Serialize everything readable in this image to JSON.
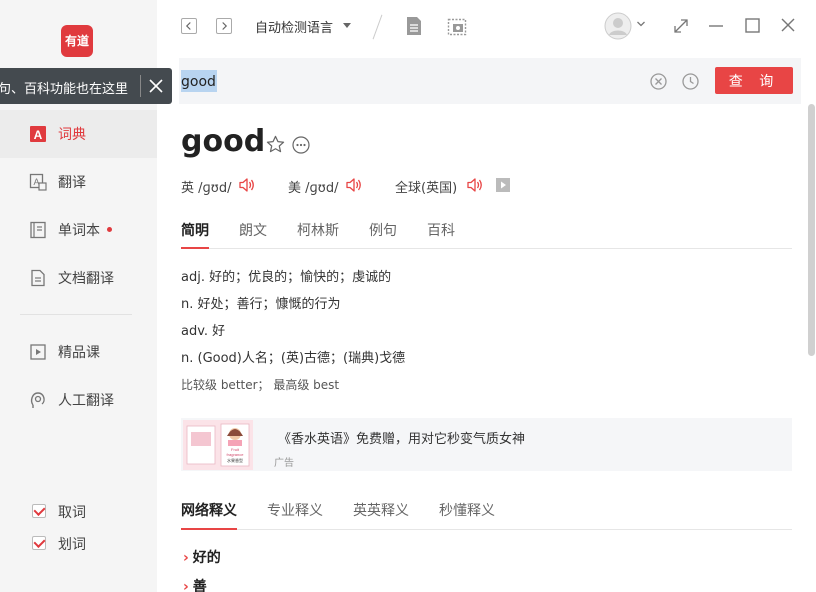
{
  "sidebar": {
    "logo_text": "有道",
    "tooltip_text": "例句、百科功能也在这里",
    "nav": [
      {
        "label": "词典",
        "icon": "dictionary-icon",
        "active": true
      },
      {
        "label": "翻译",
        "icon": "translate-icon"
      },
      {
        "label": "单词本",
        "icon": "wordbook-icon",
        "dot": true
      },
      {
        "label": "文档翻译",
        "icon": "document-icon"
      },
      {
        "label": "精品课",
        "icon": "course-icon"
      },
      {
        "label": "人工翻译",
        "icon": "human-translate-icon"
      }
    ],
    "checks": [
      {
        "label": "取词",
        "checked": true
      },
      {
        "label": "划词",
        "checked": true
      }
    ]
  },
  "toolbar": {
    "language": "自动检测语言"
  },
  "search": {
    "value": "good",
    "button_label": "查 询"
  },
  "entry": {
    "word": "good",
    "pronunciations": [
      {
        "region": "英",
        "ipa": "/ɡʊd/"
      },
      {
        "region": "美",
        "ipa": "/ɡʊd/"
      },
      {
        "region": "全球(英国)",
        "ipa": ""
      }
    ],
    "tabs": [
      "简明",
      "朗文",
      "柯林斯",
      "例句",
      "百科"
    ],
    "definitions": [
      "adj. 好的；优良的；愉快的；虔诚的",
      "n. 好处；善行；慷慨的行为",
      "adv. 好",
      "n. (Good)人名；(英)古德；(瑞典)戈德"
    ],
    "comparison": "比较级 better；  最高级 best"
  },
  "ad": {
    "text": "《香水英语》免费赠，用对它秒变气质女神",
    "label": "广告",
    "img_line1": "Fruit",
    "img_line2": "fragrance",
    "img_line3": "水果香型"
  },
  "web": {
    "tabs": [
      "网络释义",
      "专业释义",
      "英英释义",
      "秒懂释义"
    ],
    "items": [
      "好的",
      "善"
    ]
  }
}
